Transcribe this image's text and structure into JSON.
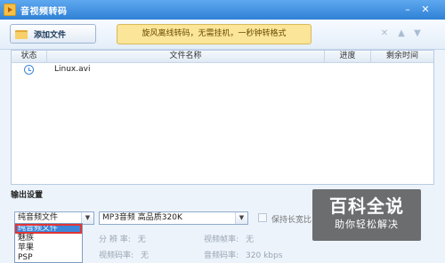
{
  "window": {
    "title": "音视频转码"
  },
  "toolbar": {
    "add_file_label": "添加文件",
    "promo_text": "旋风离线转码，无需挂机，一秒钟转格式"
  },
  "file_table": {
    "columns": [
      "状态",
      "文件名称",
      "进度",
      "剩余时间"
    ],
    "rows": [
      {
        "status_icon": "clock-icon",
        "name": "Linux.avi",
        "progress": "",
        "remaining": ""
      }
    ]
  },
  "output": {
    "section_label": "输出设置",
    "type_select_value": "纯音频文件",
    "type_options": [
      "纯音频文件",
      "魅族",
      "苹果",
      "PSP"
    ],
    "format_select_value": "MP3音频 高品质320K",
    "keep_ratio_label": "保持长宽比",
    "resolution_label": "分 辨 率:",
    "resolution_value": "无",
    "video_bitrate_label": "视频码率:",
    "video_bitrate_value": "无",
    "video_framerate_label": "视频帧率:",
    "video_framerate_value": "无",
    "audio_bitrate_label": "音频码率:",
    "audio_bitrate_value": "320 kbps"
  },
  "watermark": {
    "title": "百科全说",
    "subtitle": "助你轻松解决"
  }
}
